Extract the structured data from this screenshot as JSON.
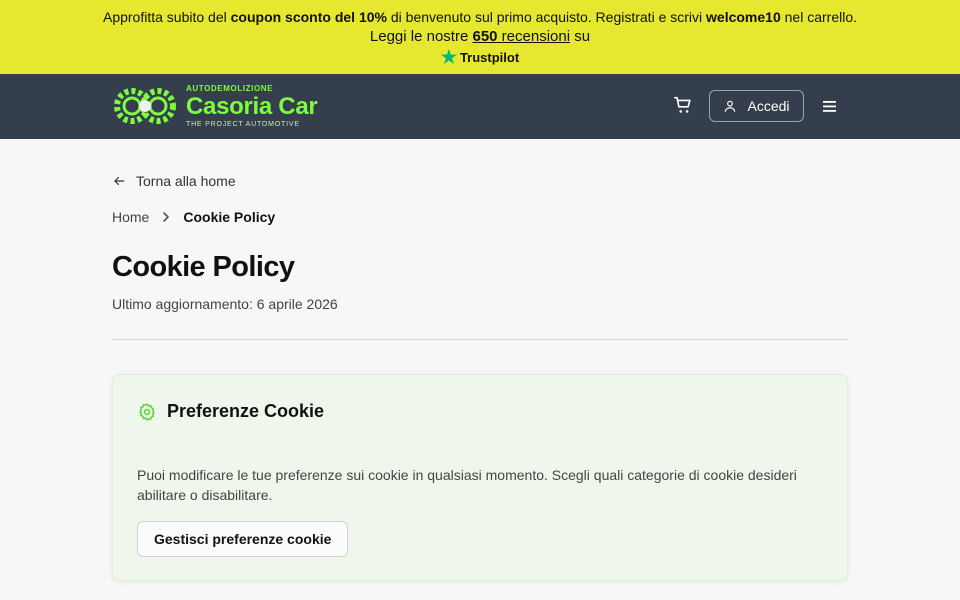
{
  "promo": {
    "line1_pre": "Approfitta subito del ",
    "line1_bold1": "coupon sconto del 10%",
    "line1_mid": " di benvenuto sul primo acquisto. Registrati e scrivi ",
    "line1_bold2": "welcome10",
    "line1_post": " nel carrello.",
    "line2_pre": "Leggi le nostre ",
    "reviews_count": "650",
    "reviews_link": " recensioni",
    "line2_post": " su",
    "trustpilot": "Trustpilot"
  },
  "header": {
    "logo_top": "AUTODEMOLIZIONE",
    "logo_name": "Casoria Car",
    "logo_sub": "THE PROJECT AUTOMOTIVE",
    "login_label": "Accedi",
    "colors": {
      "bar": "#353e4c",
      "logo": "#7cfc3c"
    }
  },
  "page": {
    "back_label": "Torna alla home",
    "breadcrumb": {
      "home": "Home",
      "current": "Cookie Policy"
    },
    "title": "Cookie Policy",
    "updated": "Ultimo aggiornamento: 6 aprile 2026"
  },
  "card": {
    "heading": "Preferenze Cookie",
    "body": "Puoi modificare le tue preferenze sui cookie in qualsiasi momento. Scegli quali categorie di cookie desideri abilitare o disabilitare.",
    "button_label": "Gestisci preferenze cookie",
    "icon": "gear-icon",
    "accent": "#7cfc3c"
  }
}
